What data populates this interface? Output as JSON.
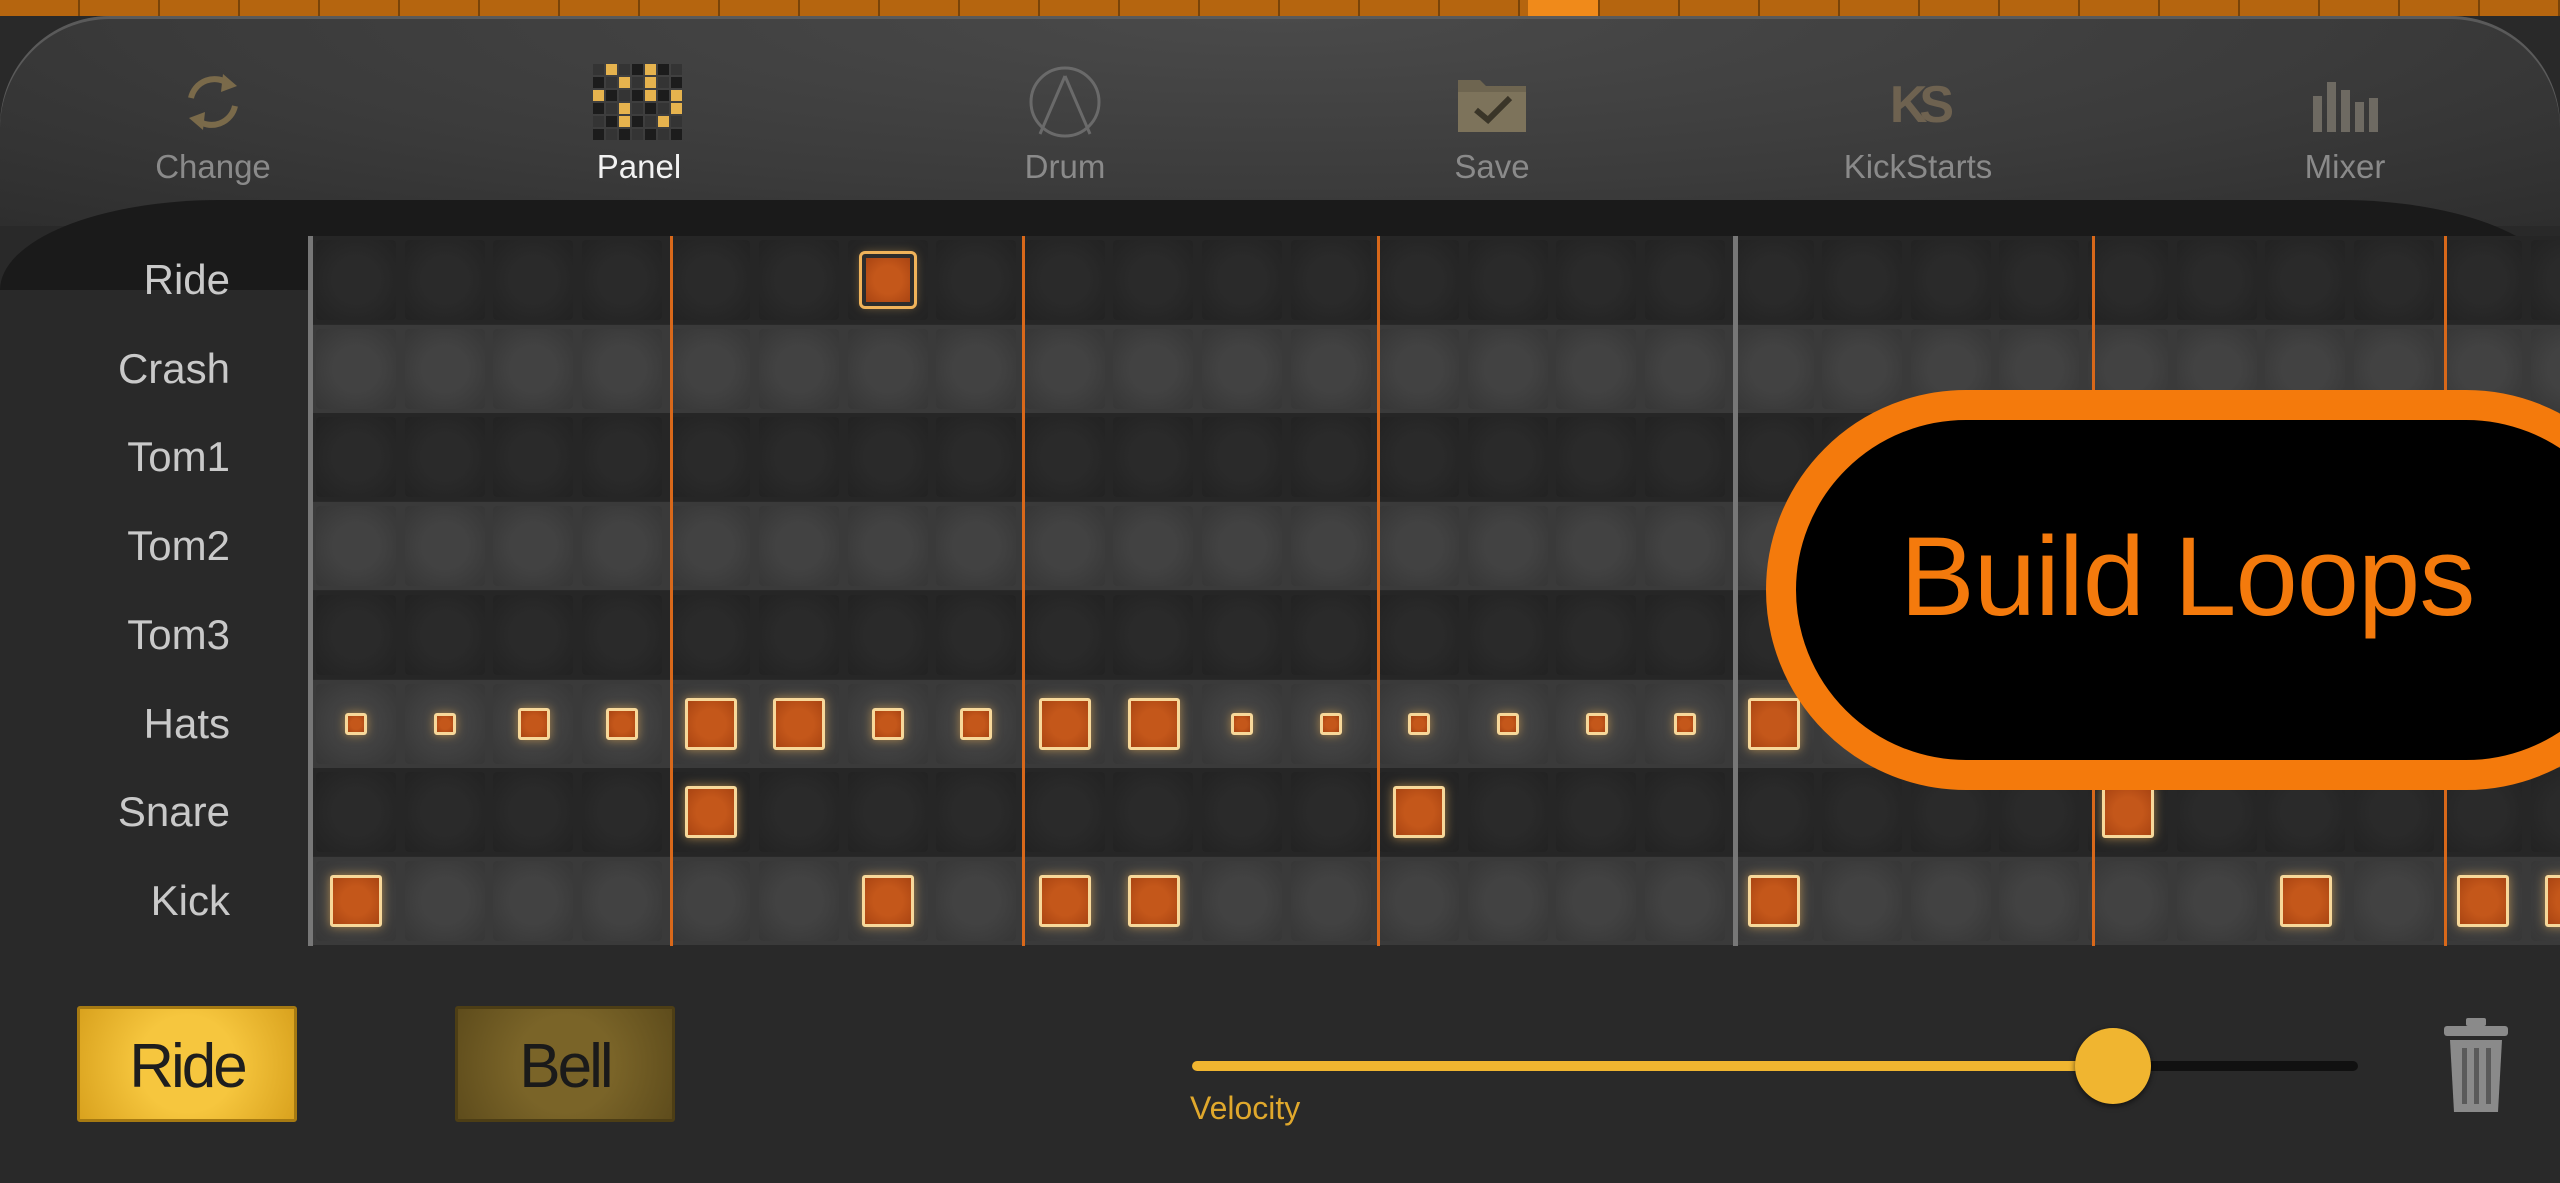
{
  "toolbar": {
    "items": [
      {
        "label": "Change",
        "icon": "refresh-icon",
        "active": false
      },
      {
        "label": "Panel",
        "icon": "panel-grid-icon",
        "active": true
      },
      {
        "label": "Drum",
        "icon": "drum-icon",
        "active": false
      },
      {
        "label": "Save",
        "icon": "folder-check-icon",
        "active": false
      },
      {
        "label": "KickStarts",
        "icon": "ks-logo-icon",
        "active": false
      },
      {
        "label": "Mixer",
        "icon": "mixer-bars-icon",
        "active": false
      }
    ]
  },
  "sequencer": {
    "rows": [
      "Ride",
      "Crash",
      "Tom1",
      "Tom2",
      "Tom3",
      "Hats",
      "Snare",
      "Kick"
    ],
    "steps_visible": 26,
    "notes": {
      "Ride": [
        {
          "step": 6,
          "velocity": "high",
          "selected": true
        }
      ],
      "Crash": [],
      "Tom1": [],
      "Tom2": [],
      "Tom3": [],
      "Hats": [
        {
          "step": 0,
          "velocity": "low"
        },
        {
          "step": 1,
          "velocity": "low"
        },
        {
          "step": 2,
          "velocity": "mid"
        },
        {
          "step": 3,
          "velocity": "mid"
        },
        {
          "step": 4,
          "velocity": "high"
        },
        {
          "step": 5,
          "velocity": "high"
        },
        {
          "step": 6,
          "velocity": "mid"
        },
        {
          "step": 7,
          "velocity": "mid"
        },
        {
          "step": 8,
          "velocity": "high"
        },
        {
          "step": 9,
          "velocity": "high"
        },
        {
          "step": 10,
          "velocity": "low"
        },
        {
          "step": 11,
          "velocity": "low"
        },
        {
          "step": 12,
          "velocity": "low"
        },
        {
          "step": 13,
          "velocity": "low"
        },
        {
          "step": 14,
          "velocity": "low"
        },
        {
          "step": 15,
          "velocity": "low"
        },
        {
          "step": 16,
          "velocity": "high"
        }
      ],
      "Snare": [
        {
          "step": 4,
          "velocity": "high"
        },
        {
          "step": 12,
          "velocity": "high"
        },
        {
          "step": 20,
          "velocity": "high"
        }
      ],
      "Kick": [
        {
          "step": 0,
          "velocity": "high"
        },
        {
          "step": 6,
          "velocity": "high"
        },
        {
          "step": 8,
          "velocity": "high"
        },
        {
          "step": 9,
          "velocity": "high"
        },
        {
          "step": 16,
          "velocity": "high"
        },
        {
          "step": 22,
          "velocity": "high"
        },
        {
          "step": 24,
          "velocity": "high"
        },
        {
          "step": 25,
          "velocity": "high"
        }
      ]
    }
  },
  "callout": {
    "text": "Build Loops"
  },
  "bottom": {
    "articulation_buttons": [
      {
        "label": "Ride",
        "selected": true
      },
      {
        "label": "Bell",
        "selected": false
      }
    ],
    "velocity": {
      "label": "Velocity",
      "value": 0.79
    },
    "trash_icon": "trash-icon"
  },
  "colors": {
    "accent_orange": "#f47a0c",
    "note_fill": "#c4571a",
    "velocity_yellow": "#f0b530",
    "grid_line": "#d8681a"
  }
}
